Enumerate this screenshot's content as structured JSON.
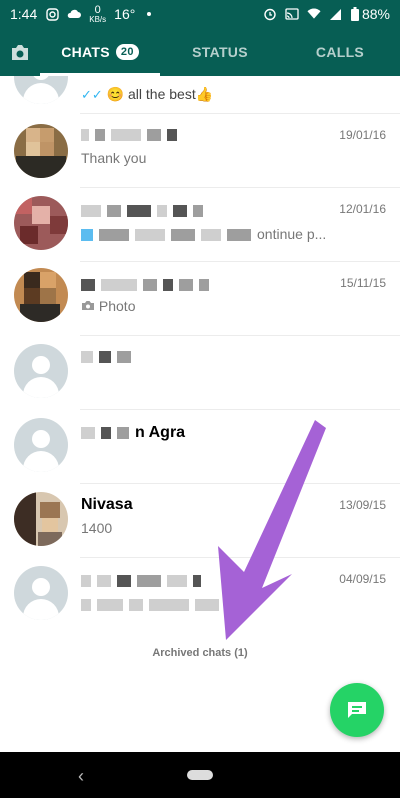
{
  "status_bar": {
    "time": "1:44",
    "speed_value": "0",
    "speed_unit": "KB/s",
    "temperature": "16°",
    "battery": "88%"
  },
  "tabs": [
    {
      "label": "CHATS",
      "badge": "20",
      "active": true
    },
    {
      "label": "STATUS",
      "active": false
    },
    {
      "label": "CALLS",
      "active": false
    }
  ],
  "chats": [
    {
      "name": "",
      "preview": "😊 all the best👍",
      "date": ""
    },
    {
      "name": "",
      "preview": "Thank you",
      "date": "19/01/16"
    },
    {
      "name": "",
      "preview": "ontinue p...",
      "date": "12/01/16"
    },
    {
      "name": "",
      "preview": "Photo",
      "date": "15/11/15"
    },
    {
      "name": "",
      "preview": "",
      "date": ""
    },
    {
      "name": "n Agra",
      "preview": "",
      "date": ""
    },
    {
      "name": "Nivasa",
      "preview": "1400",
      "date": "13/09/15"
    },
    {
      "name": "",
      "preview": "",
      "date": "04/09/15"
    }
  ],
  "archived": "Archived chats (1)",
  "colors": {
    "header": "#075e54",
    "accent": "#25d366",
    "read_ticks": "#34b7f1",
    "annotation_arrow": "#a562d6"
  },
  "icons": [
    "camera-icon",
    "new-chat-icon",
    "camera-small-icon",
    "back-icon",
    "home-icon"
  ]
}
